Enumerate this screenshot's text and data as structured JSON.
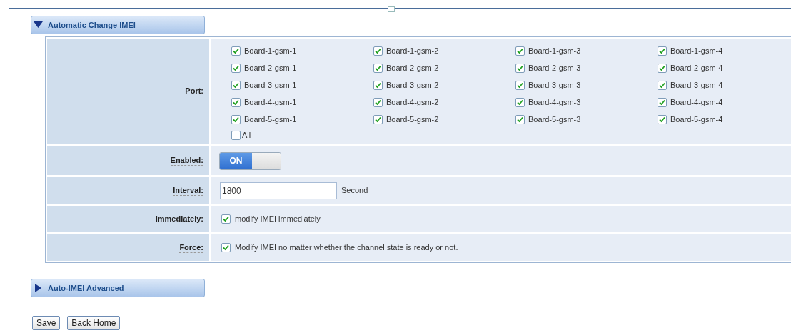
{
  "sections": [
    {
      "title": "Automatic Change IMEI",
      "expanded": true
    },
    {
      "title": "Auto-IMEI Advanced",
      "expanded": false
    }
  ],
  "port": {
    "label": "Port:",
    "options": [
      {
        "label": "Board-1-gsm-1",
        "checked": true
      },
      {
        "label": "Board-1-gsm-2",
        "checked": true
      },
      {
        "label": "Board-1-gsm-3",
        "checked": true
      },
      {
        "label": "Board-1-gsm-4",
        "checked": true
      },
      {
        "label": "Board-2-gsm-1",
        "checked": true
      },
      {
        "label": "Board-2-gsm-2",
        "checked": true
      },
      {
        "label": "Board-2-gsm-3",
        "checked": true
      },
      {
        "label": "Board-2-gsm-4",
        "checked": true
      },
      {
        "label": "Board-3-gsm-1",
        "checked": true
      },
      {
        "label": "Board-3-gsm-2",
        "checked": true
      },
      {
        "label": "Board-3-gsm-3",
        "checked": true
      },
      {
        "label": "Board-3-gsm-4",
        "checked": true
      },
      {
        "label": "Board-4-gsm-1",
        "checked": true
      },
      {
        "label": "Board-4-gsm-2",
        "checked": true
      },
      {
        "label": "Board-4-gsm-3",
        "checked": true
      },
      {
        "label": "Board-4-gsm-4",
        "checked": true
      },
      {
        "label": "Board-5-gsm-1",
        "checked": true
      },
      {
        "label": "Board-5-gsm-2",
        "checked": true
      },
      {
        "label": "Board-5-gsm-3",
        "checked": true
      },
      {
        "label": "Board-5-gsm-4",
        "checked": true
      }
    ],
    "all": {
      "label": "All",
      "checked": false
    }
  },
  "enabled": {
    "label": "Enabled:",
    "on": true,
    "text": "ON"
  },
  "interval": {
    "label": "Interval:",
    "value": "1800",
    "unit": "Second"
  },
  "immediately": {
    "label": "Immediately:",
    "checked": true,
    "text": "modify IMEI immediately"
  },
  "force": {
    "label": "Force:",
    "checked": true,
    "text": "Modify IMEI no matter whether the channel state is ready or not."
  },
  "buttons": [
    "Save",
    "Back Home"
  ]
}
